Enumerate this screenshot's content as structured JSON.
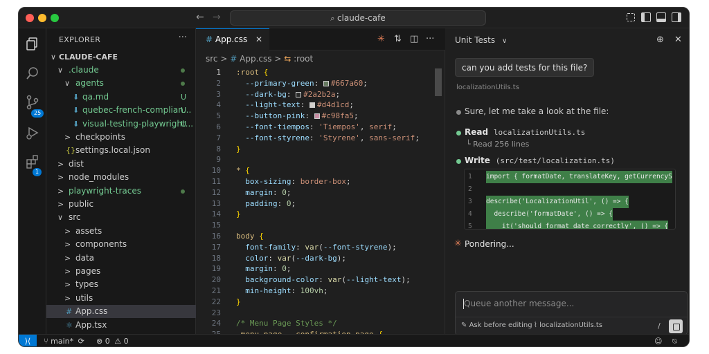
{
  "window": {
    "search_text": "claude-cafe"
  },
  "activity_bar": {
    "items": [
      {
        "icon": "files-icon"
      },
      {
        "icon": "search-icon"
      },
      {
        "icon": "source-control-icon",
        "badge": "25"
      },
      {
        "icon": "run-debug-icon"
      },
      {
        "icon": "extensions-icon",
        "badge": "1"
      }
    ]
  },
  "explorer": {
    "header": "EXPLORER",
    "more": "···",
    "root": "CLAUDE-CAFE",
    "items": [
      {
        "label": ".claude",
        "chev": "∨",
        "indent": 1,
        "color": "#73c991",
        "dot": true
      },
      {
        "label": "agents",
        "chev": "∨",
        "indent": 2,
        "color": "#73c991",
        "dot": true
      },
      {
        "label": "qa.md",
        "indent": 3,
        "icon": "markdown-icon",
        "color": "#73c991",
        "status": "U"
      },
      {
        "label": "quebec-french-complian...",
        "indent": 3,
        "icon": "markdown-icon",
        "color": "#73c991",
        "status": "U"
      },
      {
        "label": "visual-testing-playwright...",
        "indent": 3,
        "icon": "markdown-icon",
        "color": "#73c991",
        "status": "U"
      },
      {
        "label": "checkpoints",
        "chev": ">",
        "indent": 2,
        "color": "#cccccc"
      },
      {
        "label": "settings.local.json",
        "indent": 2,
        "icon": "json-icon",
        "color": "#cccccc"
      },
      {
        "label": "dist",
        "chev": ">",
        "indent": 1,
        "color": "#cccccc"
      },
      {
        "label": "node_modules",
        "chev": ">",
        "indent": 1,
        "color": "#cccccc"
      },
      {
        "label": "playwright-traces",
        "chev": ">",
        "indent": 1,
        "color": "#73c991",
        "dot": true
      },
      {
        "label": "public",
        "chev": ">",
        "indent": 1,
        "color": "#cccccc"
      },
      {
        "label": "src",
        "chev": "∨",
        "indent": 1,
        "color": "#cccccc"
      },
      {
        "label": "assets",
        "chev": ">",
        "indent": 2,
        "color": "#cccccc"
      },
      {
        "label": "components",
        "chev": ">",
        "indent": 2,
        "color": "#cccccc"
      },
      {
        "label": "data",
        "chev": ">",
        "indent": 2,
        "color": "#cccccc"
      },
      {
        "label": "pages",
        "chev": ">",
        "indent": 2,
        "color": "#cccccc"
      },
      {
        "label": "types",
        "chev": ">",
        "indent": 2,
        "color": "#cccccc"
      },
      {
        "label": "utils",
        "chev": ">",
        "indent": 2,
        "color": "#cccccc"
      },
      {
        "label": "App.css",
        "indent": 2,
        "icon": "css-icon",
        "color": "#cccccc",
        "selected": true
      },
      {
        "label": "App.tsx",
        "indent": 2,
        "icon": "react-icon",
        "color": "#cccccc"
      }
    ]
  },
  "editor": {
    "tab": {
      "label": "App.css",
      "close": "✕"
    },
    "breadcrumb": {
      "part1": "src",
      "sep": ">",
      "part2": "App.css",
      "part3": ":root"
    },
    "lines": [
      {
        "n": "1",
        "segs": [
          [
            "k-sel",
            ":root "
          ],
          [
            "k-brace",
            "{"
          ]
        ]
      },
      {
        "n": "2",
        "segs": [
          [
            "k-prop",
            "  --primary-green"
          ],
          [
            "",
            ": "
          ],
          [
            "sw:#667a60",
            ""
          ],
          [
            "k-val",
            "#667a60"
          ],
          [
            "",
            ";"
          ]
        ]
      },
      {
        "n": "3",
        "segs": [
          [
            "k-prop",
            "  --dark-bg"
          ],
          [
            "",
            ": "
          ],
          [
            "sw:#2a2b2a",
            ""
          ],
          [
            "k-val",
            "#2a2b2a"
          ],
          [
            "",
            ";"
          ]
        ]
      },
      {
        "n": "4",
        "segs": [
          [
            "k-prop",
            "  --light-text"
          ],
          [
            "",
            ": "
          ],
          [
            "sw:#d4d1cd",
            ""
          ],
          [
            "k-val",
            "#d4d1cd"
          ],
          [
            "",
            ";"
          ]
        ]
      },
      {
        "n": "5",
        "segs": [
          [
            "k-prop",
            "  --button-pink"
          ],
          [
            "",
            ": "
          ],
          [
            "sw:#c98fa5",
            ""
          ],
          [
            "k-val",
            "#c98fa5"
          ],
          [
            "",
            ";"
          ]
        ]
      },
      {
        "n": "6",
        "segs": [
          [
            "k-prop",
            "  --font-tiempos"
          ],
          [
            "",
            ": "
          ],
          [
            "k-val",
            "'Tiempos'"
          ],
          [
            "",
            ", "
          ],
          [
            "k-val",
            "serif"
          ],
          [
            "",
            ";"
          ]
        ]
      },
      {
        "n": "7",
        "segs": [
          [
            "k-prop",
            "  --font-styrene"
          ],
          [
            "",
            ": "
          ],
          [
            "k-val",
            "'Styrene'"
          ],
          [
            "",
            ", "
          ],
          [
            "k-val",
            "sans-serif"
          ],
          [
            "",
            ";"
          ]
        ]
      },
      {
        "n": "8",
        "segs": [
          [
            "k-brace",
            "}"
          ]
        ]
      },
      {
        "n": "9",
        "segs": []
      },
      {
        "n": "10",
        "segs": [
          [
            "k-sel",
            "* "
          ],
          [
            "k-brace",
            "{"
          ]
        ]
      },
      {
        "n": "11",
        "segs": [
          [
            "k-prop",
            "  box-sizing"
          ],
          [
            "",
            ": "
          ],
          [
            "k-val",
            "border-box"
          ],
          [
            "",
            ";"
          ]
        ]
      },
      {
        "n": "12",
        "segs": [
          [
            "k-prop",
            "  margin"
          ],
          [
            "",
            ": "
          ],
          [
            "k-num",
            "0"
          ],
          [
            "",
            ";"
          ]
        ]
      },
      {
        "n": "13",
        "segs": [
          [
            "k-prop",
            "  padding"
          ],
          [
            "",
            ": "
          ],
          [
            "k-num",
            "0"
          ],
          [
            "",
            ";"
          ]
        ]
      },
      {
        "n": "14",
        "segs": [
          [
            "k-brace",
            "}"
          ]
        ]
      },
      {
        "n": "15",
        "segs": []
      },
      {
        "n": "16",
        "segs": [
          [
            "k-sel",
            "body "
          ],
          [
            "k-brace",
            "{"
          ]
        ]
      },
      {
        "n": "17",
        "segs": [
          [
            "k-prop",
            "  font-family"
          ],
          [
            "",
            ": "
          ],
          [
            "k-fn",
            "var"
          ],
          [
            "",
            "("
          ],
          [
            "k-var",
            "--font-styrene"
          ],
          [
            "",
            ");"
          ]
        ]
      },
      {
        "n": "18",
        "segs": [
          [
            "k-prop",
            "  color"
          ],
          [
            "",
            ": "
          ],
          [
            "k-fn",
            "var"
          ],
          [
            "",
            "("
          ],
          [
            "k-var",
            "--dark-bg"
          ],
          [
            "",
            ");"
          ]
        ]
      },
      {
        "n": "19",
        "segs": [
          [
            "k-prop",
            "  margin"
          ],
          [
            "",
            ": "
          ],
          [
            "k-num",
            "0"
          ],
          [
            "",
            ";"
          ]
        ]
      },
      {
        "n": "20",
        "segs": [
          [
            "k-prop",
            "  background-color"
          ],
          [
            "",
            ": "
          ],
          [
            "k-fn",
            "var"
          ],
          [
            "",
            "("
          ],
          [
            "k-var",
            "--light-text"
          ],
          [
            "",
            ");"
          ]
        ]
      },
      {
        "n": "21",
        "segs": [
          [
            "k-prop",
            "  min-height"
          ],
          [
            "",
            ": "
          ],
          [
            "k-num",
            "100vh"
          ],
          [
            "",
            ";"
          ]
        ]
      },
      {
        "n": "22",
        "segs": [
          [
            "k-brace",
            "}"
          ]
        ]
      },
      {
        "n": "23",
        "segs": []
      },
      {
        "n": "24",
        "segs": [
          [
            "k-cmt",
            "/* Menu Page Styles */"
          ]
        ]
      },
      {
        "n": "25",
        "segs": [
          [
            "k-sel",
            ".menu-page, .confirmation-page "
          ],
          [
            "k-brace",
            "{"
          ]
        ]
      }
    ]
  },
  "chat": {
    "title": "Unit Tests",
    "title_chevron": "∨",
    "user_message": "can you add tests for this file?",
    "context_file": "localizationUtils.ts",
    "step1": "Sure, let me take a look at the file:",
    "read_label": "Read",
    "read_file": "localizationUtils.ts",
    "read_detail": "└ Read 256 lines",
    "write_label": "Write",
    "write_file": "(src/test/localization.ts)",
    "code_lines": [
      {
        "n": "1",
        "t": "import { formatDate, translateKey, getCurrencyS",
        "add": true
      },
      {
        "n": "2",
        "t": "",
        "add": false
      },
      {
        "n": "3",
        "t": "describe('LocalizationUtil', () => {",
        "add": true
      },
      {
        "n": "4",
        "t": "  describe('formatDate', () => {",
        "add": true
      },
      {
        "n": "5",
        "t": "    it('should format date correctly', () => {",
        "add": true
      }
    ],
    "status": "Pondering...",
    "input_placeholder": "Queue another message...",
    "footer_mode": "Ask before editing",
    "footer_file": "localizationUtils.ts",
    "footer_slash": "/"
  },
  "statusbar": {
    "branch": "main*",
    "problems": "0",
    "warnings": "0"
  },
  "colors": {
    "accent": "#0078d4",
    "git_untracked": "#73c991",
    "pondering": "#e8825a"
  }
}
